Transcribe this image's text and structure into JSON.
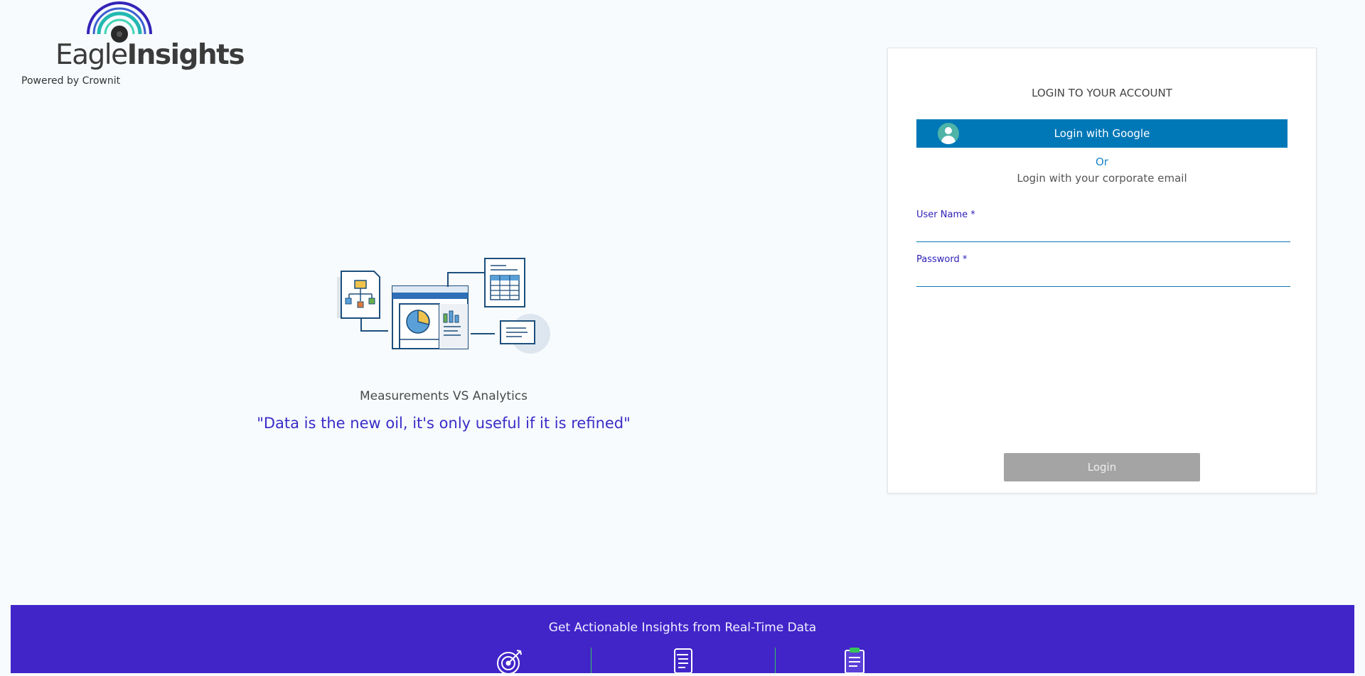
{
  "brand": {
    "logo_regular": "Eagle",
    "logo_bold": "Insights",
    "powered_by": "Powered by Crownit"
  },
  "hero": {
    "tagline": "Measurements VS Analytics",
    "quote": "\"Data is the new oil, it's only useful if it is refined\""
  },
  "login": {
    "title": "LOGIN TO YOUR ACCOUNT",
    "google_label": "Login with Google",
    "or_text": "Or",
    "corporate_text": "Login with your corporate email",
    "username_label": "User Name *",
    "username_value": "",
    "password_label": "Password *",
    "password_value": "",
    "submit_label": "Login"
  },
  "footer": {
    "title": "Get Actionable Insights from Real-Time Data",
    "icons": [
      "target-icon",
      "document-list-icon",
      "clipboard-icon"
    ]
  },
  "colors": {
    "primary_blue": "#0078b8",
    "brand_purple": "#4125c9",
    "quote_text": "#3a2cc8",
    "field_label": "#2e20b8",
    "disabled_button": "#a4a4a4",
    "divider_green": "#35c45a"
  }
}
